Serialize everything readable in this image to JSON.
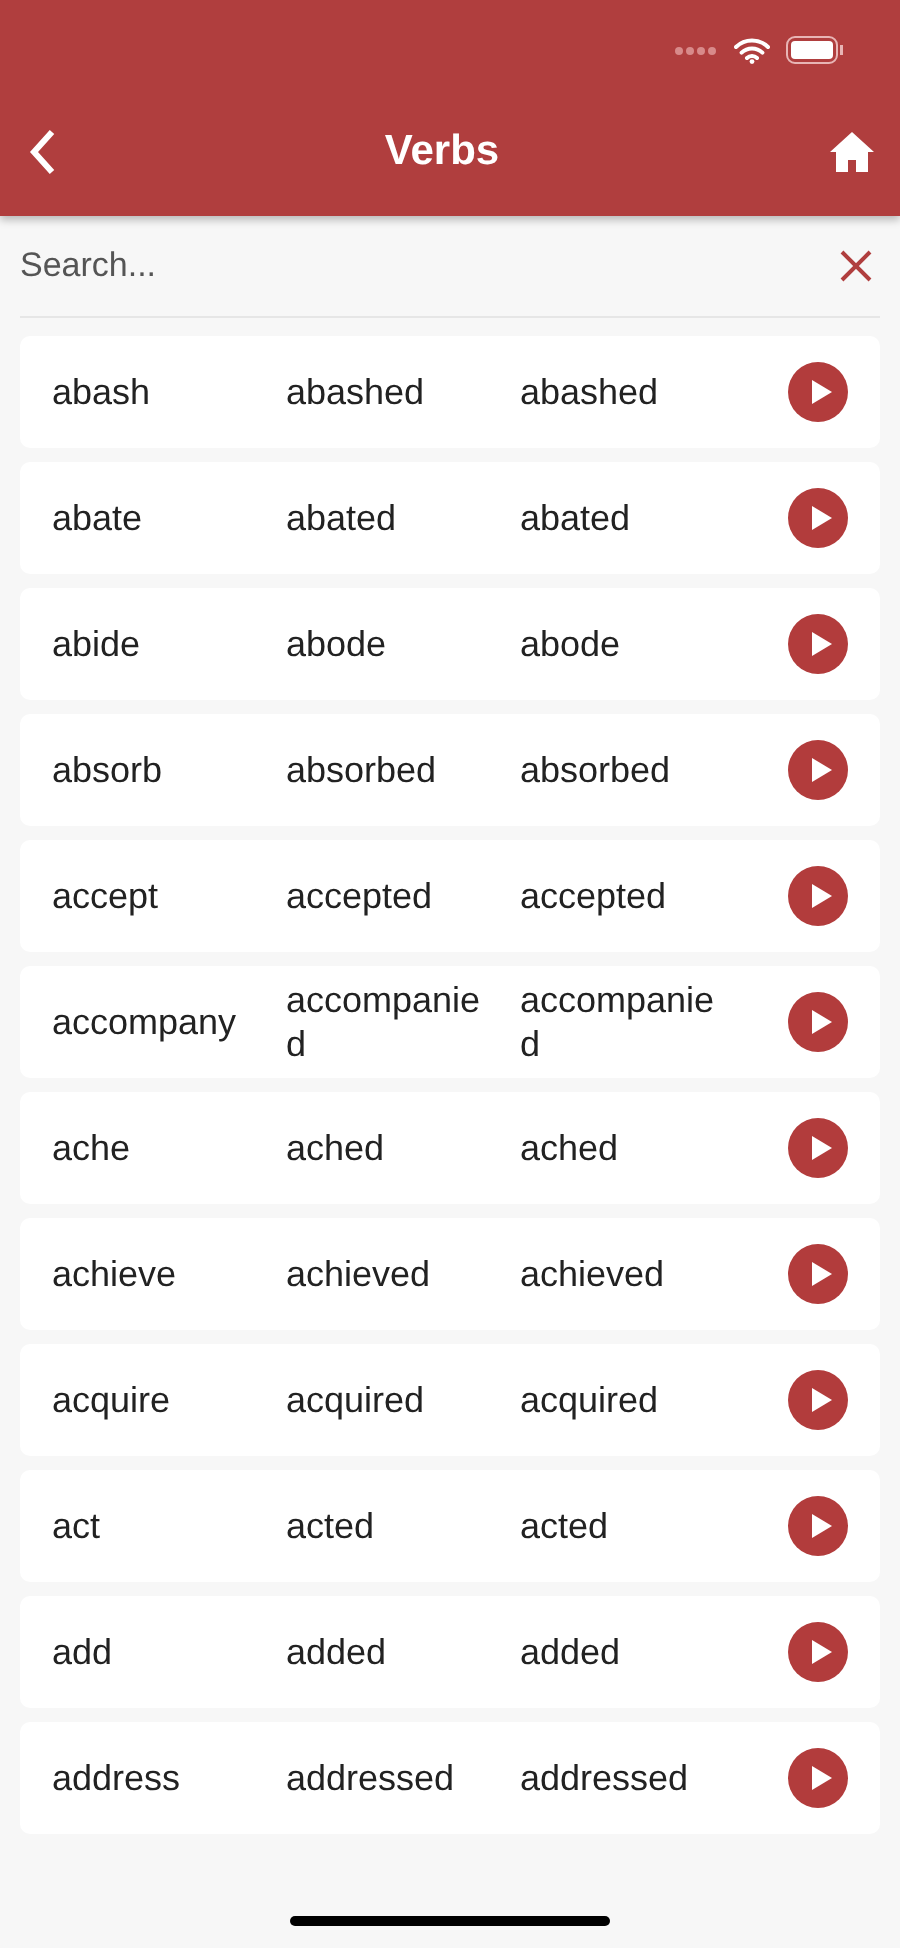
{
  "header": {
    "title": "Verbs"
  },
  "search": {
    "placeholder": "Search..."
  },
  "verbs": [
    {
      "base": "abash",
      "past": "abashed",
      "participle": "abashed"
    },
    {
      "base": "abate",
      "past": "abated",
      "participle": "abated"
    },
    {
      "base": "abide",
      "past": "abode",
      "participle": "abode"
    },
    {
      "base": "absorb",
      "past": "absorbed",
      "participle": "absorbed"
    },
    {
      "base": "accept",
      "past": "accepted",
      "participle": "accepted"
    },
    {
      "base": "accompany",
      "past": "accompanied",
      "participle": "accompanied"
    },
    {
      "base": "ache",
      "past": "ached",
      "participle": "ached"
    },
    {
      "base": "achieve",
      "past": "achieved",
      "participle": "achieved"
    },
    {
      "base": "acquire",
      "past": "acquired",
      "participle": "acquired"
    },
    {
      "base": "act",
      "past": "acted",
      "participle": "acted"
    },
    {
      "base": "add",
      "past": "added",
      "participle": "added"
    },
    {
      "base": "address",
      "past": "addressed",
      "participle": "addressed"
    }
  ]
}
